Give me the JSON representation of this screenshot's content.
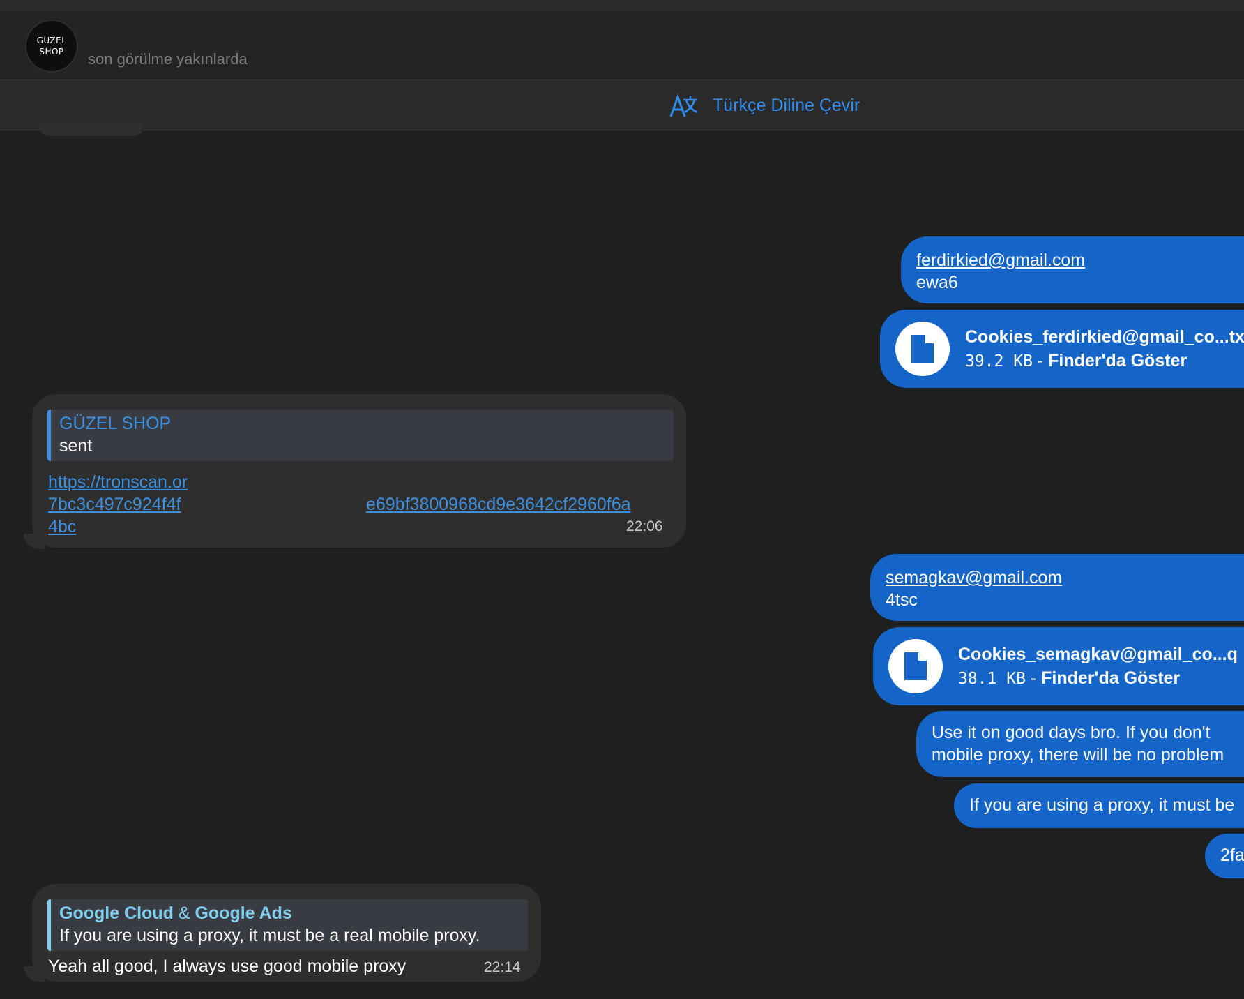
{
  "header": {
    "avatar_text_line1": "GUZEL",
    "avatar_text_line2": "SHOP",
    "status": "son görülme yakınlarda"
  },
  "translate_bar": {
    "label": "Türkçe Diline Çevir"
  },
  "messages": {
    "out1": {
      "email": "ferdirkied@gmail.com",
      "code": "ewa6"
    },
    "file1": {
      "name": "Cookies_ferdirkied@gmail_co...txt",
      "size": "39.2 KB",
      "separator": " - ",
      "action": "Finder'da Göster"
    },
    "in1": {
      "reply_name": "GÜZEL SHOP",
      "reply_text": "sent",
      "link_line1": "https://tronscan.or",
      "link_line2a": "7bc3c497c924f4f",
      "link_line2b": "e69bf3800968cd9e3642cf2960f6a",
      "link_line3": "4bc",
      "time": "22:06"
    },
    "out2": {
      "email": "semagkav@gmail.com",
      "code": "4tsc"
    },
    "file2": {
      "name": "Cookies_semagkav@gmail_co...q",
      "size": "38.1 KB",
      "separator": " - ",
      "action": "Finder'da Göster"
    },
    "out3": {
      "line1": "Use it on good days bro. If you don't",
      "line2": "mobile proxy, there will be no problem"
    },
    "out4": {
      "text": "If you are using a proxy, it must be"
    },
    "out5": {
      "text": "2fa"
    },
    "in2": {
      "reply_name_part1": "Google Cloud",
      "reply_name_amp": "&",
      "reply_name_part2": "Google Ads",
      "reply_text": "If you are using a proxy, it must be a real mobile proxy.",
      "text": "Yeah all good, I always use good mobile proxy",
      "time": "22:14"
    }
  }
}
